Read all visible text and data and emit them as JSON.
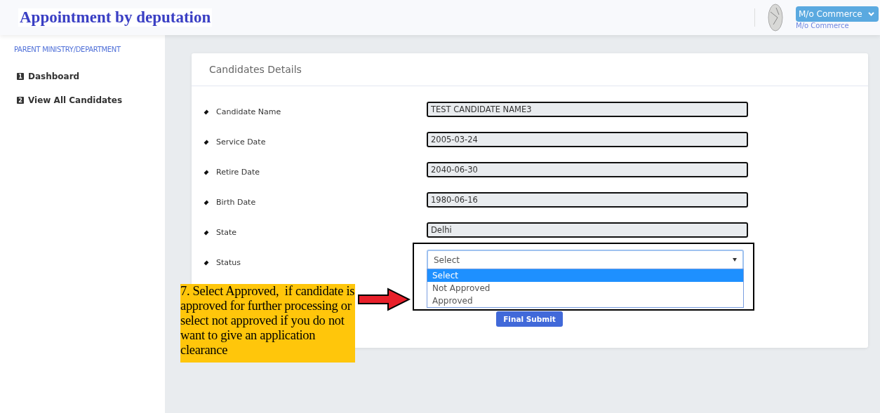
{
  "header": {
    "title": "Appointment by deputation",
    "user_button": "M/o Commerce",
    "user_subtitle": "M/o Commerce"
  },
  "sidebar": {
    "heading": "PARENT MINISTRY/DEPARTMENT",
    "items": [
      {
        "number": "1",
        "label": "Dashboard"
      },
      {
        "number": "2",
        "label": "View All Candidates"
      }
    ]
  },
  "card": {
    "title": "Candidates Details",
    "fields": [
      {
        "label": "Candidate Name",
        "value": "TEST CANDIDATE NAME3"
      },
      {
        "label": "Service Date",
        "value": "2005-03-24"
      },
      {
        "label": "Retire Date",
        "value": "2040-06-30"
      },
      {
        "label": "Birth Date",
        "value": "1980-06-16"
      },
      {
        "label": "State",
        "value": "Delhi"
      }
    ],
    "status": {
      "label": "Status",
      "value": "Select",
      "expanded": true,
      "options": [
        {
          "label": "Select",
          "selected": true
        },
        {
          "label": "Not Approved",
          "selected": false
        },
        {
          "label": "Approved",
          "selected": false
        }
      ]
    },
    "submit_button": "Final Submit"
  },
  "annotation": {
    "text": "7. Select Approved,  if candidate is approved for further processing or select not approved if you do not want to give an application clearance"
  }
}
